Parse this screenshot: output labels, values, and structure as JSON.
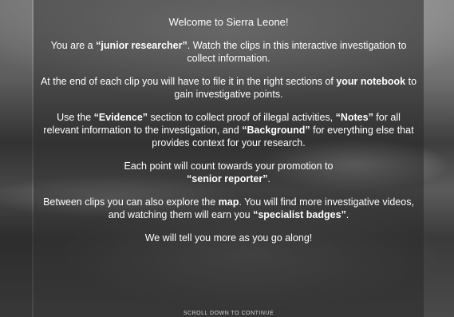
{
  "intro": {
    "title": "Welcome to Sierra Leone!",
    "p1": {
      "a": "You are a ",
      "b": "“junior researcher”",
      "c": ". Watch the clips in this interactive investigation to collect information."
    },
    "p2": {
      "a": "At the end of each clip you will have to file it in the right sections of ",
      "b": "your notebook",
      "c": " to gain investigative points."
    },
    "p3": {
      "a": "Use the ",
      "b": "“Evidence”",
      "c": " section to collect proof of illegal activities, ",
      "d": "“Notes”",
      "e": " for all relevant information to the investigation, and ",
      "f": "“Background”",
      "g": " for everything else that provides context for your research."
    },
    "p4": {
      "a": "Each point will count towards your promotion to ",
      "b": "“senior reporter”",
      "c": "."
    },
    "p5": {
      "a": "Between clips you can also explore the ",
      "b": "map",
      "c": ". You will find more investigative videos, and watching them will earn you ",
      "d": "“specialist badges”",
      "e": "."
    },
    "p6": "We will tell you more as you go along!",
    "scroll_hint": "SCROLL DOWN TO CONTINUE"
  }
}
